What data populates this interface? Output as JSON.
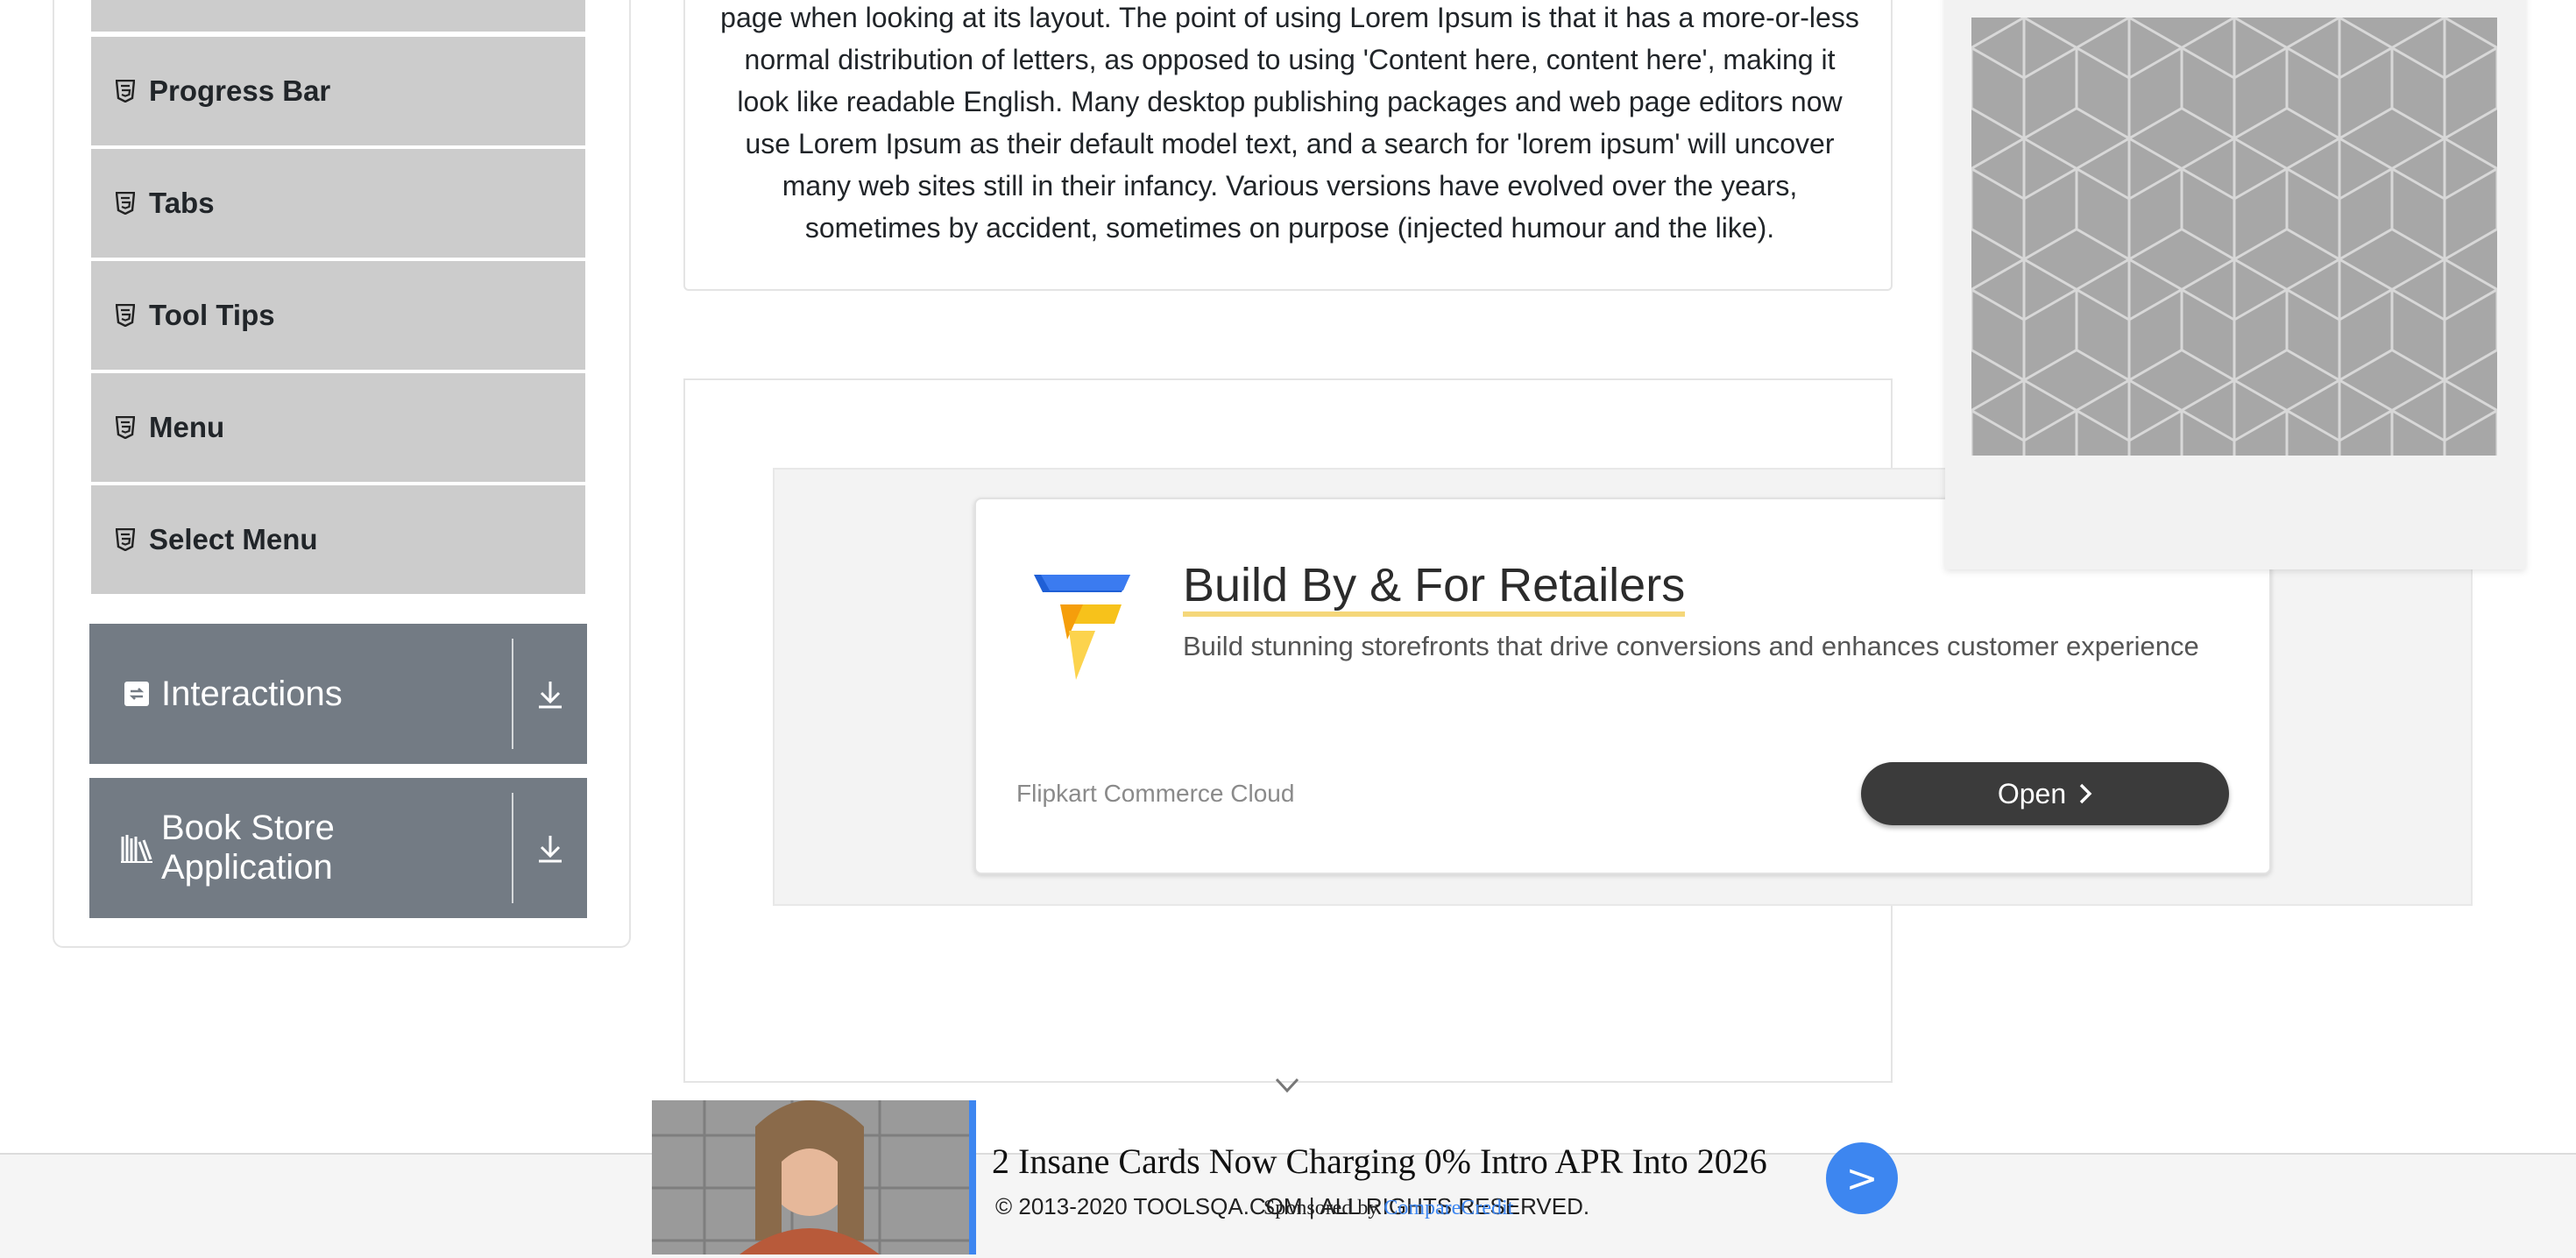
{
  "sidebar": {
    "items": [
      {
        "label": "Progress Bar",
        "icon": "html5-icon"
      },
      {
        "label": "Tabs",
        "icon": "html5-icon"
      },
      {
        "label": "Tool Tips",
        "icon": "html5-icon"
      },
      {
        "label": "Menu",
        "icon": "html5-icon"
      },
      {
        "label": "Select Menu",
        "icon": "html5-icon"
      }
    ],
    "groups": [
      {
        "label": "Interactions",
        "icon": "interactions-icon",
        "toggle_icon": "download-arrow-icon"
      },
      {
        "label": "Book Store Application",
        "icon": "books-icon",
        "toggle_icon": "download-arrow-icon"
      }
    ]
  },
  "main": {
    "lorem_text": "page when looking at its layout. The point of using Lorem Ipsum is that it has a more-or-less normal distribution of letters, as opposed to using 'Content here, content here', making it look like readable English. Many desktop publishing packages and web page editors now use Lorem Ipsum as their default model text, and a search for 'lorem ipsum' will uncover many web sites still in their infancy. Various versions have evolved over the years, sometimes by accident, sometimes on purpose (injected humour and the like)."
  },
  "ad": {
    "title": "Build By & For Retailers",
    "description": "Build stunning storefronts that drive conversions and enhances customer experience",
    "brand": "Flipkart Commerce Cloud",
    "open_label": "Open"
  },
  "banner": {
    "headline": "2 Insane Cards Now Charging 0% Intro APR Into 2026",
    "sponsor_prefix": "Sponsored by ",
    "sponsor_name": "CompareCredit",
    "button_label": ">"
  },
  "footer": {
    "copyright": "© 2013-2020 TOOLSQA.COM | ALL RIGHTS RESERVED."
  },
  "colors": {
    "sidebar_item_bg": "#cccccc",
    "group_header_bg": "#737b84",
    "accent_blue": "#3d86f0",
    "open_button_bg": "#3b3b3b"
  }
}
